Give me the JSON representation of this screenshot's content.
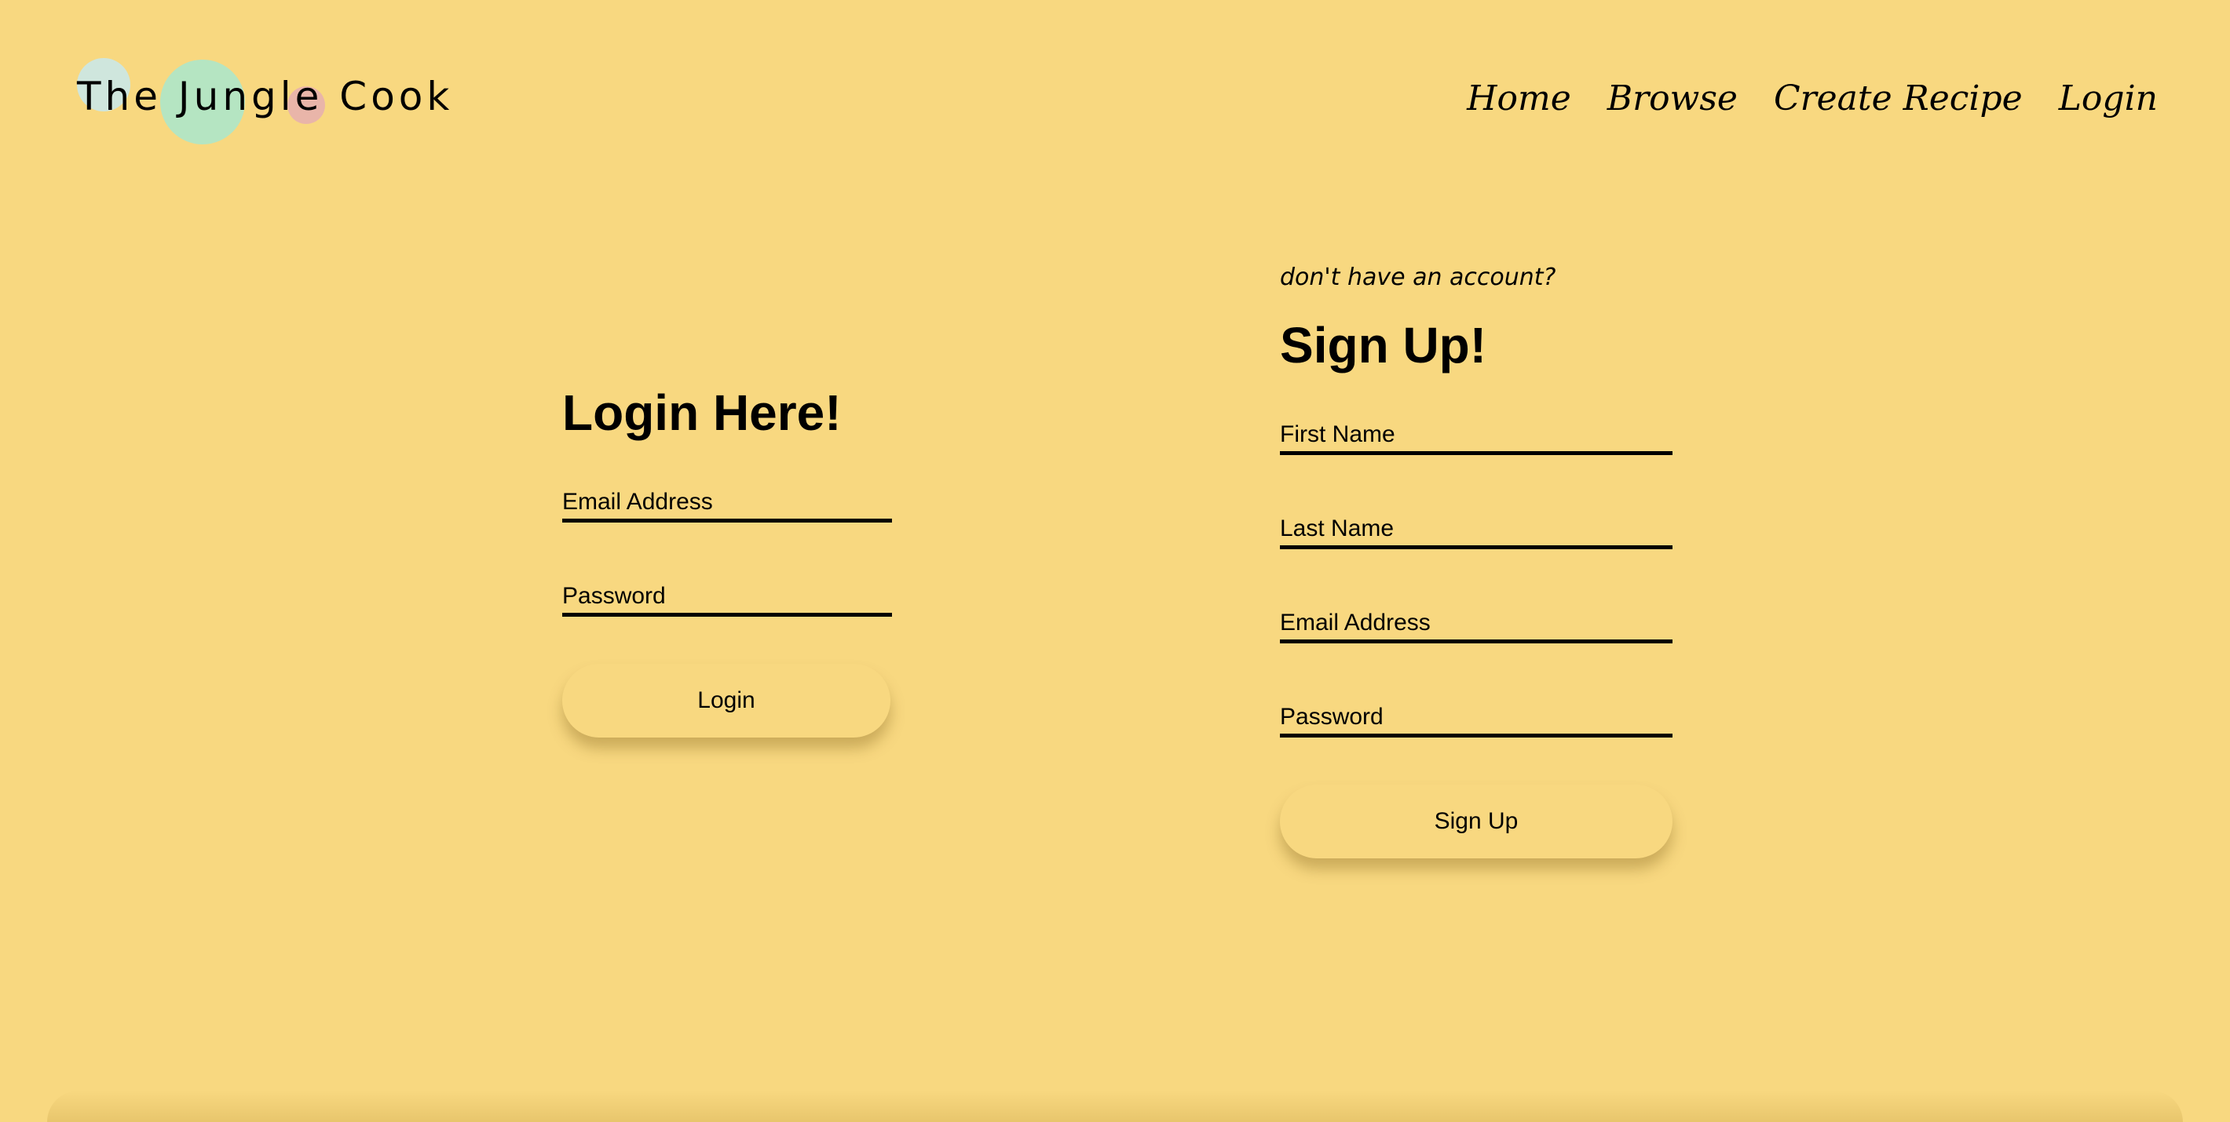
{
  "logo": {
    "text": "The Jungle Cook"
  },
  "nav": {
    "items": [
      {
        "label": "Home"
      },
      {
        "label": "Browse"
      },
      {
        "label": "Create Recipe"
      },
      {
        "label": "Login"
      }
    ]
  },
  "login": {
    "heading": "Login Here!",
    "email_placeholder": "Email Address",
    "password_placeholder": "Password",
    "button_label": "Login"
  },
  "signup": {
    "prompt": "don't have an account?",
    "heading": "Sign Up!",
    "first_name_placeholder": "First Name",
    "last_name_placeholder": "Last Name",
    "email_placeholder": "Email Address",
    "password_placeholder": "Password",
    "button_label": "Sign Up"
  },
  "colors": {
    "background": "#f8d880",
    "logo_dot_blue": "#cfe6dd",
    "logo_dot_green": "#b5e5c2",
    "logo_dot_pink": "#e9b5a9",
    "text": "#000000"
  }
}
